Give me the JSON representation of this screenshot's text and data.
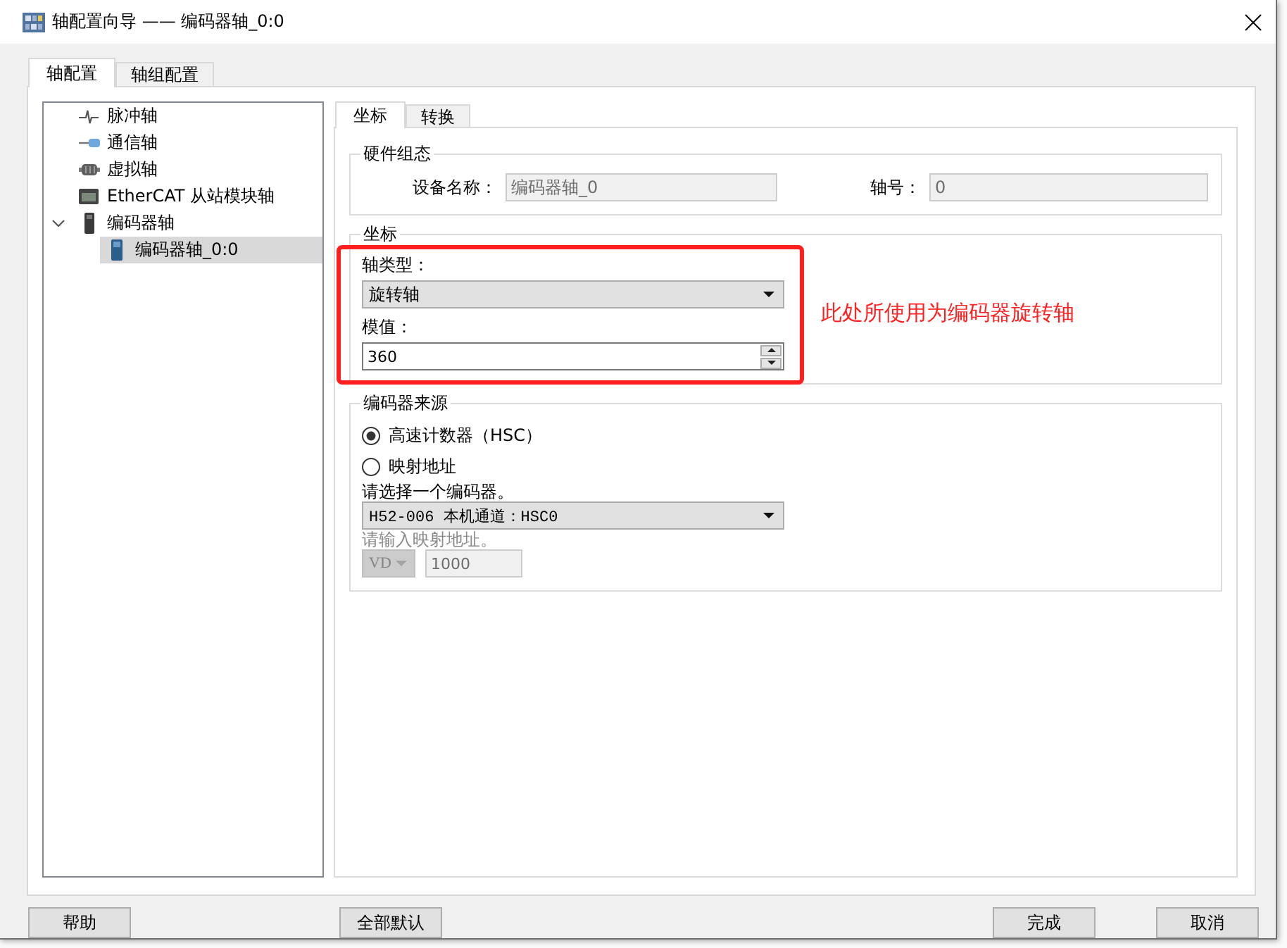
{
  "window": {
    "title": "轴配置向导 —— 编码器轴_0:0"
  },
  "tabs": [
    {
      "label": "轴配置",
      "selected": true
    },
    {
      "label": "轴组配置",
      "selected": false
    }
  ],
  "tree": {
    "items": [
      {
        "label": "脉冲轴",
        "kind": "pulse",
        "selected": false
      },
      {
        "label": "通信轴",
        "kind": "comm",
        "selected": false
      },
      {
        "label": "虚拟轴",
        "kind": "virtual",
        "selected": false
      },
      {
        "label": "EtherCAT 从站模块轴",
        "kind": "ethercat",
        "selected": false
      },
      {
        "label": "编码器轴",
        "kind": "encoder_group",
        "selected": false,
        "expanded": true,
        "children": [
          {
            "label": "编码器轴_0:0",
            "kind": "encoder",
            "selected": true
          }
        ]
      }
    ]
  },
  "sub_tabs": [
    {
      "label": "坐标",
      "selected": true
    },
    {
      "label": "转换",
      "selected": false
    }
  ],
  "hardware_group": {
    "title": "硬件组态",
    "fields": [
      {
        "label": "设备名称：",
        "value": "编码器轴_0",
        "disabled": true
      },
      {
        "label": "轴号：",
        "value": "0",
        "disabled": true
      }
    ]
  },
  "coordinate_group": {
    "title": "坐标",
    "axis_type": {
      "label": "轴类型：",
      "value": "旋转轴"
    },
    "modulo": {
      "label": "模值：",
      "value": "360"
    }
  },
  "annotation": {
    "text": "此处所使用为编码器旋转轴"
  },
  "encoder_source_group": {
    "title": "编码器来源",
    "options": [
      {
        "label": "高速计数器（HSC）",
        "selected": true
      },
      {
        "label": "映射地址",
        "selected": false
      }
    ],
    "encoder_select": {
      "label": "请选择一个编码器。",
      "value": "H52-006 本机通道：HSC0"
    },
    "mapping": {
      "label": "请输入映射地址。",
      "disabled": true,
      "area": "VD",
      "address": "1000"
    }
  },
  "buttons": [
    {
      "label": "帮助"
    },
    {
      "label": "全部默认"
    },
    {
      "label": "完成"
    },
    {
      "label": "取消"
    }
  ]
}
